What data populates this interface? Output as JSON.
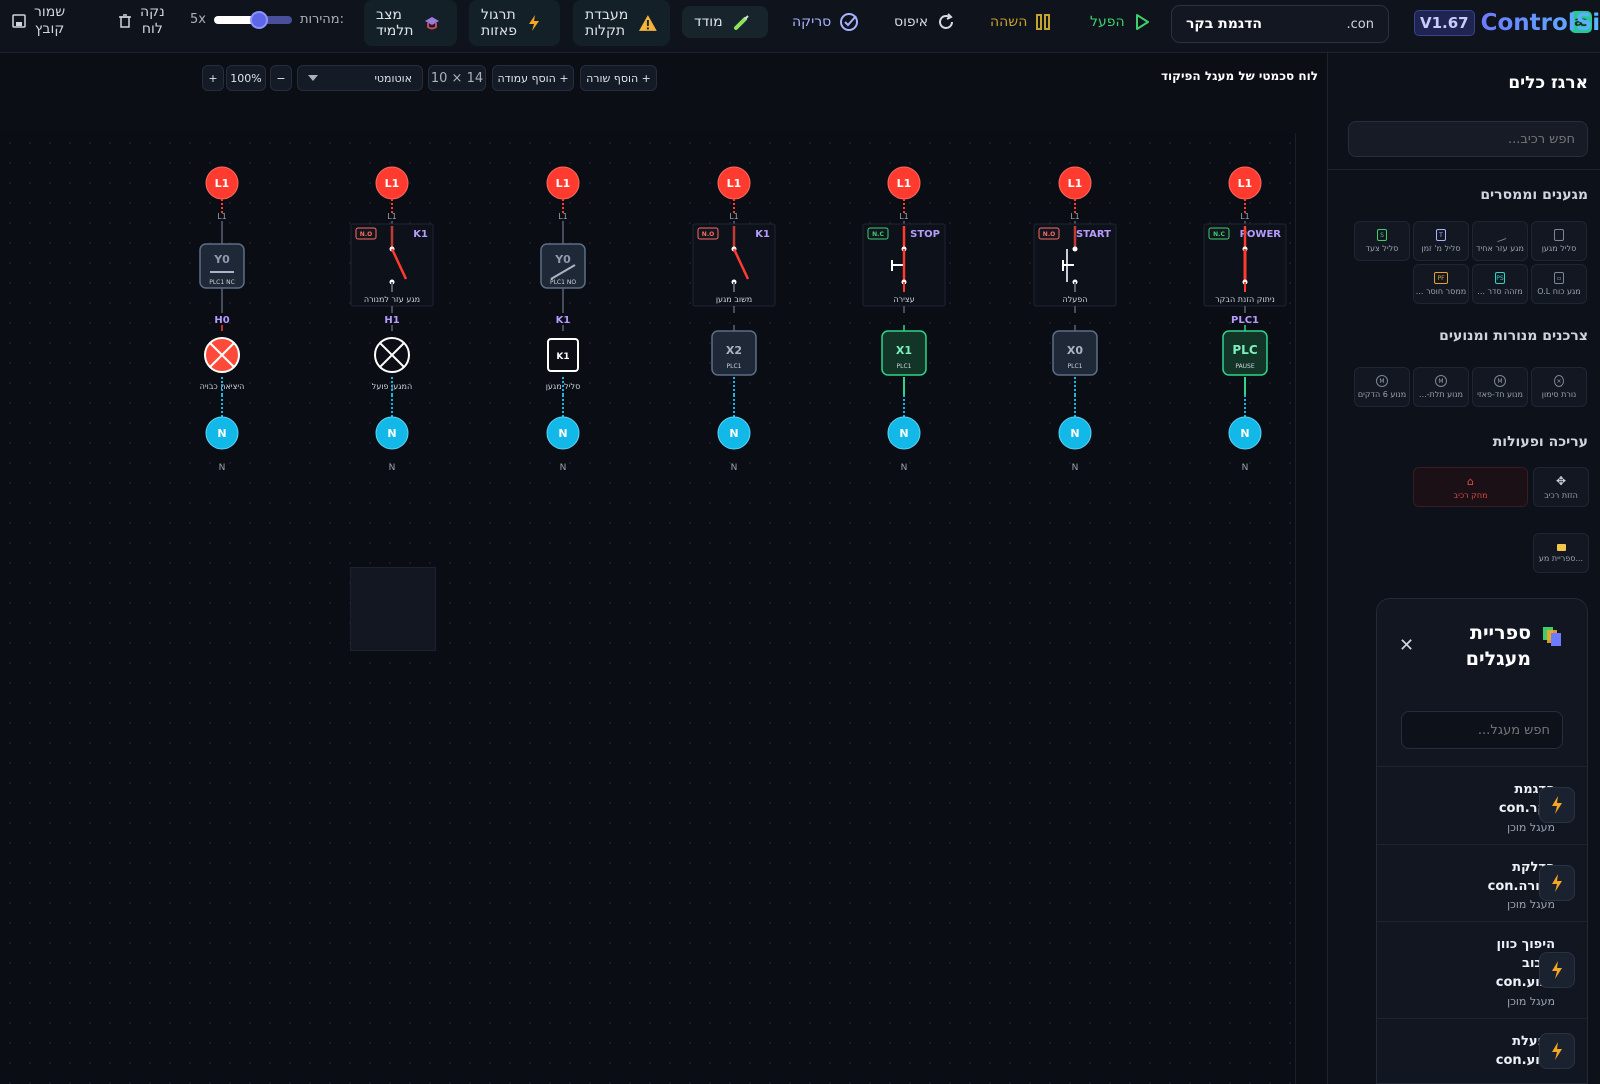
{
  "app": {
    "name": "ControlSim",
    "version": "V1.67",
    "logo": "æ"
  },
  "project": {
    "name": "הדגמת בקר",
    "ext": ".con"
  },
  "toolbar": {
    "run": "הפעל",
    "pause": "השהה",
    "reset": "איפוס",
    "scan": "סריקה",
    "meter": "מודד",
    "fault_lab": [
      "מעבדת",
      "תקלות"
    ],
    "phase_drill": [
      "תרגול",
      "פאזות"
    ],
    "student_mode": [
      "מצב",
      "תלמיד"
    ],
    "speed_label": "מהירות:",
    "speed_value": "5x",
    "speed_fraction": 0.55,
    "clear": [
      "נקה",
      "לוח"
    ],
    "save": [
      "שמור",
      "קובץ"
    ]
  },
  "canvas": {
    "title": "לוח סכמטי של מעגל הפיקוד",
    "add_row": "+ הוסף שורה",
    "add_col": "+ הוסף עמודה",
    "size": "10 × 14",
    "mode": "אוטומטי",
    "zoom": "100%",
    "zoom_out": "−",
    "zoom_in": "+"
  },
  "rungs": [
    {
      "top": "L1",
      "wire": "L1",
      "ctype": "nc",
      "ctag": "N.C",
      "cname": "POWER",
      "clabel": "ניתוק הזנת הבקר",
      "otag": "PLC1",
      "otype": "plc",
      "otext": "PLC",
      "osub": "PAUSE",
      "olabel": "",
      "bottom": "N",
      "blabel": "N"
    },
    {
      "top": "L1",
      "wire": "L1",
      "ctype": "pb-no",
      "ctag": "N.O",
      "cname": "START",
      "clabel": "הפעלה",
      "otag": "",
      "otype": "box",
      "otext": "X0",
      "osub": "PLC1",
      "olabel": "",
      "bottom": "N",
      "blabel": "N"
    },
    {
      "top": "L1",
      "wire": "L1",
      "ctype": "pb-nc",
      "ctag": "N.C",
      "cname": "STOP",
      "clabel": "עצירה",
      "otag": "",
      "otype": "box-on",
      "otext": "X1",
      "osub": "PLC1",
      "olabel": "",
      "bottom": "N",
      "blabel": "N"
    },
    {
      "top": "L1",
      "wire": "L1",
      "ctype": "no",
      "ctag": "N.O",
      "cname": "K1",
      "clabel": "משוב מגען",
      "otag": "",
      "otype": "box",
      "otext": "X2",
      "osub": "PLC1",
      "olabel": "",
      "bottom": "N",
      "blabel": "N"
    },
    {
      "top": "L1",
      "wire": "L1",
      "ctype": "plc-no",
      "ctag": "",
      "cname": "Y0",
      "clabel": "PLC1 NO",
      "otag": "K1",
      "otype": "coil",
      "otext": "K1",
      "osub": "",
      "olabel": "סליל מגען",
      "bottom": "N",
      "blabel": "N"
    },
    {
      "top": "L1",
      "wire": "L1",
      "ctype": "no",
      "ctag": "N.O",
      "cname": "K1",
      "clabel": "מגע עזר למנורה",
      "otag": "H1",
      "otype": "lamp",
      "otext": "",
      "osub": "",
      "olabel": "המגען פועל",
      "bottom": "N",
      "blabel": "N"
    },
    {
      "top": "L1",
      "wire": "L1",
      "ctype": "plc-nc",
      "ctag": "",
      "cname": "Y0",
      "clabel": "PLC1 NC",
      "otag": "H0",
      "otype": "lamp-on",
      "otext": "",
      "osub": "",
      "olabel": "היציאה כבויה",
      "bottom": "N",
      "blabel": "N"
    }
  ],
  "sidebar": {
    "title": "ארגז כלים",
    "search_placeholder": "חפש רכיב...",
    "sections": [
      {
        "title": "מגענים וממסרים",
        "items": [
          "סליל מגען",
          "מגע עזר אחיד",
          "סליל מ' זמן",
          "סליל צעד",
          "מגע כוח O.L",
          "מזהה סדר ...",
          "ממסר חוסר ..."
        ]
      },
      {
        "title": "צרכנים מנורות ומנועים",
        "items": [
          "נורת סימון",
          "מנוע חד-פאזי",
          "מנוע תלת-...",
          "מנוע 6 הדקים"
        ]
      },
      {
        "title": "עריכה ופעולות",
        "items": [
          "הזזת רכיב",
          "מחק רכיב",
          "ספריית מע..."
        ]
      }
    ]
  },
  "library": {
    "title": "ספריית מעגלים",
    "search_placeholder": "חפש מעגל...",
    "items": [
      {
        "name": [
          "הדגמת",
          "בקר.con"
        ],
        "sub": "מעגל מוכן"
      },
      {
        "name": [
          "הדלקת",
          "מנורה.con"
        ],
        "sub": "מעגל מוכן"
      },
      {
        "name": [
          "היפוך כוון",
          "סיבוב",
          "מנוע.con"
        ],
        "sub": "מעגל מוכן"
      },
      {
        "name": [
          "הפעלת",
          "מנוע.con"
        ],
        "sub": ""
      }
    ]
  },
  "colors": {
    "l1": "#ff3b30",
    "n": "#11b8e8",
    "plc": "#2ed48a",
    "purple": "#b79cff",
    "accent": "#6c7bff",
    "run": "#3ecf6c",
    "pause": "#c7a12e",
    "lamp_on": "#ff4a3a"
  }
}
